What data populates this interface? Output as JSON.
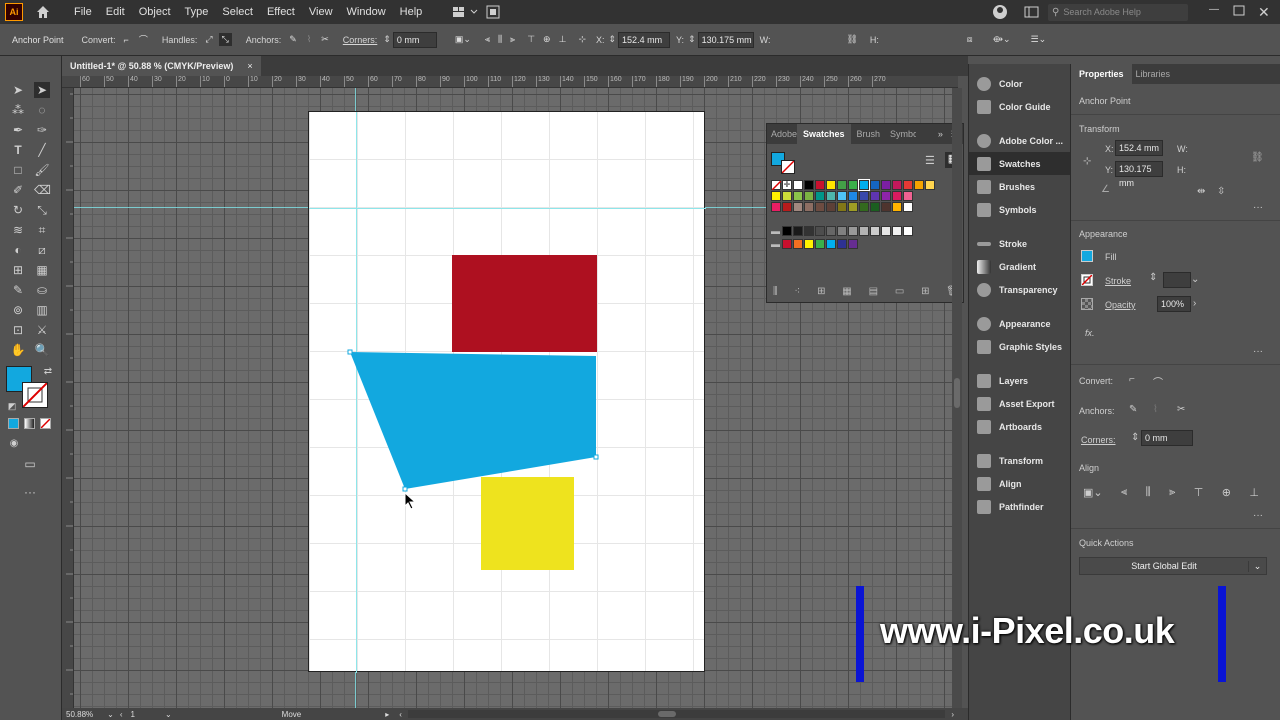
{
  "menubar": {
    "logo": "Ai",
    "items": [
      "File",
      "Edit",
      "Object",
      "Type",
      "Select",
      "Effect",
      "View",
      "Window",
      "Help"
    ],
    "search_placeholder": "Search Adobe Help"
  },
  "control": {
    "mode_label": "Anchor Point",
    "convert_label": "Convert:",
    "handles_label": "Handles:",
    "anchors_label": "Anchors:",
    "corners_label": "Corners:",
    "corners_value": "0 mm",
    "x_label": "X:",
    "x_value": "152.4 mm",
    "y_label": "Y:",
    "y_value": "130.175 mm",
    "w_label": "W:",
    "h_label": "H:"
  },
  "document_tab": {
    "title": "Untitled-1* @ 50.88 % (CMYK/Preview)",
    "close": "×"
  },
  "ruler": {
    "labels": [
      "60",
      "50",
      "40",
      "30",
      "20",
      "10",
      "0",
      "10",
      "20",
      "30",
      "40",
      "50",
      "60",
      "70",
      "80",
      "90",
      "100",
      "110",
      "120",
      "130",
      "140",
      "150",
      "160",
      "170",
      "180",
      "190",
      "200",
      "210",
      "220",
      "230",
      "240",
      "250",
      "260",
      "270"
    ]
  },
  "canvas": {
    "shapes": {
      "red_rect_color": "#ae1020",
      "blue_poly_color": "#12a8df",
      "yellow_rect_color": "#eee31e"
    }
  },
  "swatches_panel": {
    "tabs": [
      "Adobe",
      "Swatches",
      "Brush",
      "Symbo"
    ],
    "active_tab": "Swatches",
    "colors_row1": [
      "#ffffff",
      "#000000",
      "#c8102e",
      "#ffe600",
      "#43a047",
      "#3ab04a",
      "#00aeef",
      "#1565c0",
      "#7b1fa2",
      "#c2185b",
      "#e53935",
      "#f4a300",
      "#ffd54f"
    ],
    "colors_row2": [
      "#fff200",
      "#cddc39",
      "#8bc34a",
      "#7cb342",
      "#009688",
      "#4db6ac",
      "#4fc3f7",
      "#1e88e5",
      "#3949ab",
      "#5e35b1",
      "#8e24aa",
      "#d81b60",
      "#f06292"
    ],
    "colors_row3": [
      "#e91e63",
      "#b71c1c",
      "#a1887f",
      "#8d6e63",
      "#6d4c41",
      "#5d4037",
      "#827717",
      "#9e9d24",
      "#33691e",
      "#1b5e20",
      "#4e342e",
      "#ffb300",
      "#ffffff"
    ],
    "grays": [
      "#000000",
      "#1a1a1a",
      "#333333",
      "#4d4d4d",
      "#666666",
      "#808080",
      "#999999",
      "#b3b3b3",
      "#cccccc",
      "#e6e6e6",
      "#f2f2f2",
      "#ffffff"
    ],
    "group2": [
      "#c8102e",
      "#f36f21",
      "#fff200",
      "#3ab04a",
      "#00aeef",
      "#2e3192",
      "#662d91"
    ]
  },
  "dock": {
    "items": [
      "Color",
      "Color Guide",
      "Adobe Color ...",
      "Swatches",
      "Brushes",
      "Symbols",
      "Stroke",
      "Gradient",
      "Transparency",
      "Appearance",
      "Graphic Styles",
      "Layers",
      "Asset Export",
      "Artboards",
      "Transform",
      "Align",
      "Pathfinder"
    ]
  },
  "properties": {
    "tab_properties": "Properties",
    "tab_libraries": "Libraries",
    "selection_type": "Anchor Point",
    "transform_heading": "Transform",
    "x_label": "X:",
    "x_value": "152.4 mm",
    "y_label": "Y:",
    "y_value": "130.175 mm",
    "w_label": "W:",
    "h_label": "H:",
    "appearance_heading": "Appearance",
    "fill_label": "Fill",
    "stroke_label": "Stroke",
    "opacity_label": "Opacity",
    "opacity_value": "100%",
    "fx_label": "fx.",
    "convert_label": "Convert:",
    "anchors_label": "Anchors:",
    "corners_label": "Corners:",
    "corners_value": "0 mm",
    "align_heading": "Align",
    "quick_actions_heading": "Quick Actions",
    "global_edit_button": "Start Global Edit",
    "fill_color": "#12a8df"
  },
  "status": {
    "zoom": "50.88%",
    "artboard": "1",
    "tool": "Move"
  },
  "watermark": {
    "text": "www.i-Pixel.co.uk",
    "bar_color": "#0a14d4"
  }
}
